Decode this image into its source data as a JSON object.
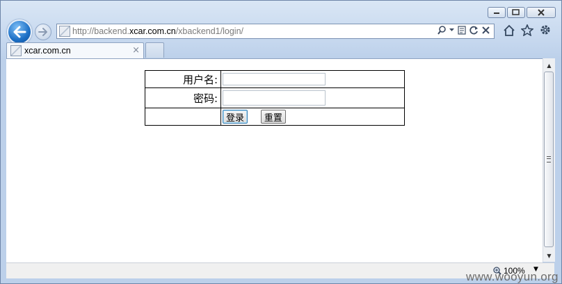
{
  "browser": {
    "url_prefix": "http://backend.",
    "url_domain": "xcar.com.cn",
    "url_path": "/xbackend1/login/",
    "tab_title": "xcar.com.cn",
    "tab_close": "×",
    "zoom": "100%",
    "zoom_drop": "▼"
  },
  "login": {
    "username_label": "用户名:",
    "password_label": "密码:",
    "username_value": "",
    "password_value": "",
    "login_button": "登录",
    "reset_button": "重置"
  },
  "watermark": "www.wooyun.org",
  "colors": {
    "accent": "#1c6fc5",
    "frame": "#c5d7ee"
  }
}
